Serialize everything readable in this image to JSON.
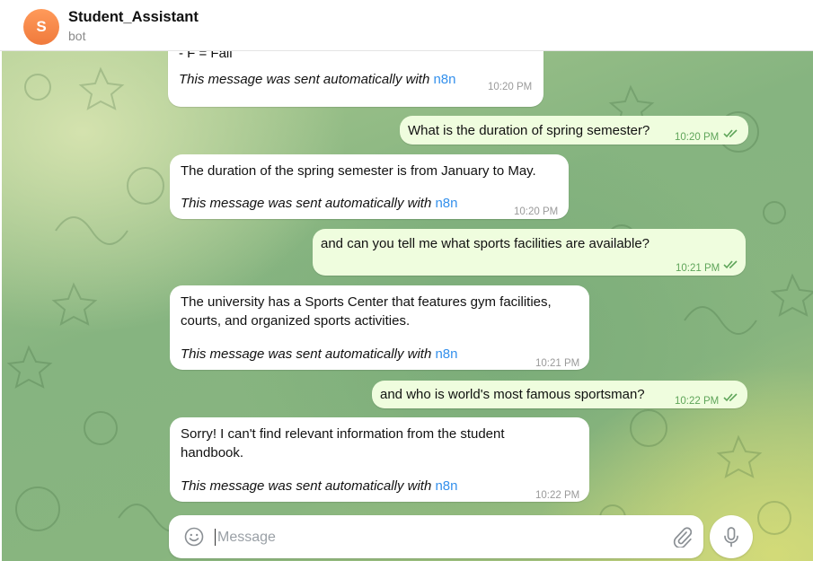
{
  "header": {
    "avatar_letter": "S",
    "title": "Student_Assistant",
    "subtitle": "bot",
    "avatar_color": "#f58a4b"
  },
  "messages": [
    {
      "dir": "in",
      "text": "- F = Fall",
      "auto_text": "This message was sent automatically with",
      "auto_link": "n8n",
      "time": "10:20 PM"
    },
    {
      "dir": "out",
      "text": "What is the duration of spring semester?",
      "time": "10:20 PM",
      "read": true
    },
    {
      "dir": "in",
      "text": "The duration of the spring semester is from January to May.",
      "auto_text": "This message was sent automatically with",
      "auto_link": "n8n",
      "time": "10:20 PM"
    },
    {
      "dir": "out",
      "text": "and can you tell me what sports facilities are available?",
      "time": "10:21 PM",
      "read": true
    },
    {
      "dir": "in",
      "text_lines": [
        "The university has a Sports Center that features gym facilities,",
        "courts, and organized sports activities."
      ],
      "auto_text": "This message was sent automatically with",
      "auto_link": "n8n",
      "time": "10:21 PM"
    },
    {
      "dir": "out",
      "text": "and who is world's most famous sportsman?",
      "time": "10:22 PM",
      "read": true
    },
    {
      "dir": "in",
      "text_lines": [
        "Sorry! I can't find relevant information from the student",
        "handbook."
      ],
      "auto_text": "This message was sent automatically with",
      "auto_link": "n8n",
      "time": "10:22 PM"
    }
  ],
  "composer": {
    "placeholder": "Message",
    "emoji_icon": "smile-icon",
    "attach_icon": "paperclip-icon",
    "mic_icon": "microphone-icon"
  },
  "colors": {
    "incoming_bubble": "#ffffff",
    "outgoing_bubble": "#effdde",
    "link": "#3390ec",
    "read_check": "#5fa55a"
  }
}
